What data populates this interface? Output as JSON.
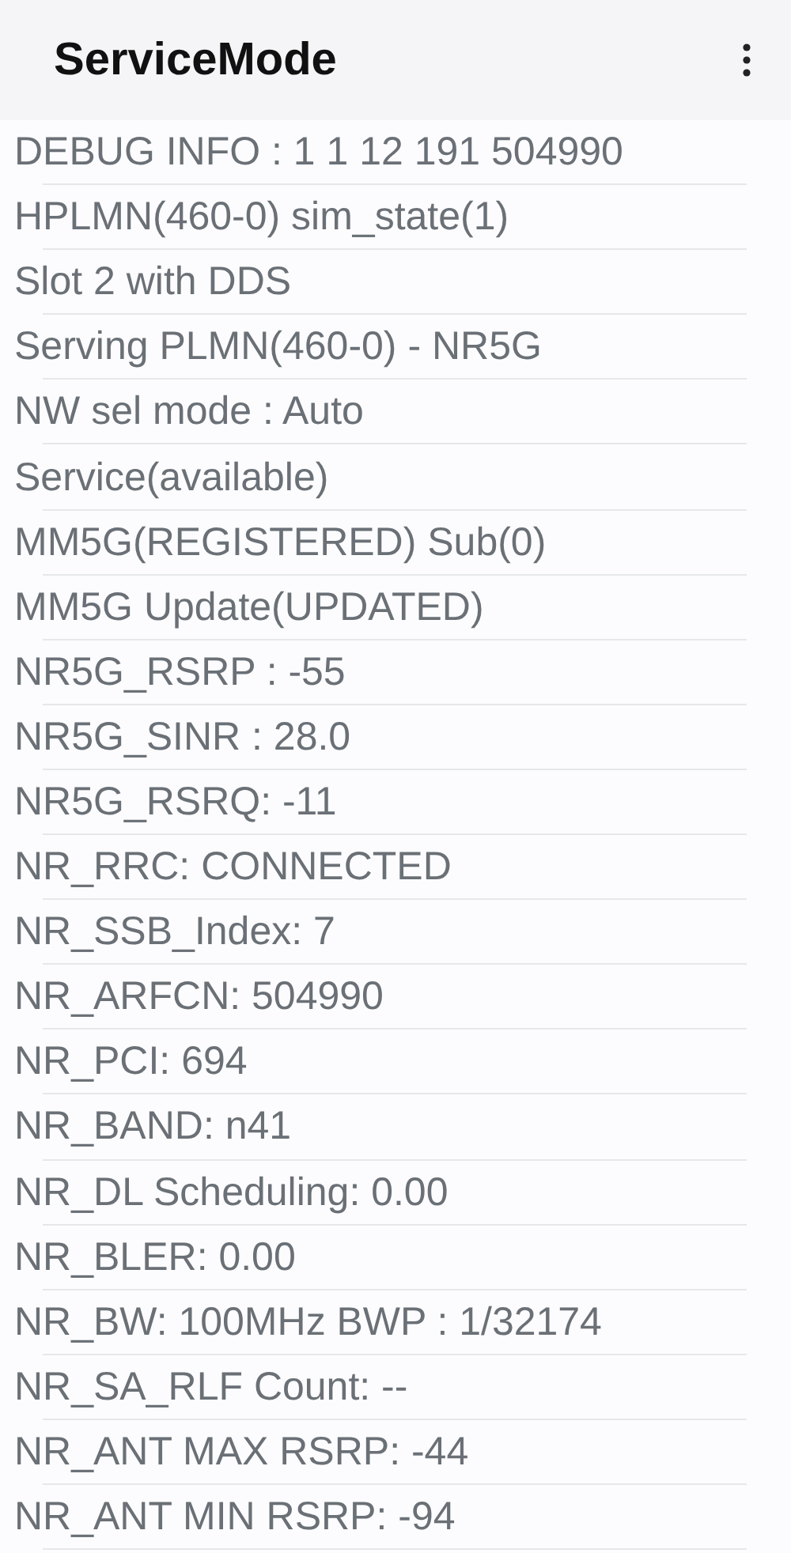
{
  "app_bar": {
    "title": "ServiceMode"
  },
  "lines": [
    "DEBUG INFO : 1 1 12 191 504990",
    "HPLMN(460-0) sim_state(1)",
    "Slot 2 with DDS",
    "Serving PLMN(460-0) - NR5G",
    "NW sel mode : Auto",
    "Service(available)",
    "MM5G(REGISTERED) Sub(0)",
    "MM5G Update(UPDATED)",
    "NR5G_RSRP : -55",
    "NR5G_SINR : 28.0",
    "NR5G_RSRQ: -11",
    "NR_RRC: CONNECTED",
    "NR_SSB_Index: 7",
    "NR_ARFCN: 504990",
    "NR_PCI: 694",
    "NR_BAND: n41",
    "NR_DL Scheduling: 0.00",
    "NR_BLER: 0.00",
    "NR_BW: 100MHz BWP : 1/32174",
    "NR_SA_RLF Count: --",
    "NR_ANT MAX RSRP: -44",
    "NR_ANT MIN RSRP: -94"
  ]
}
